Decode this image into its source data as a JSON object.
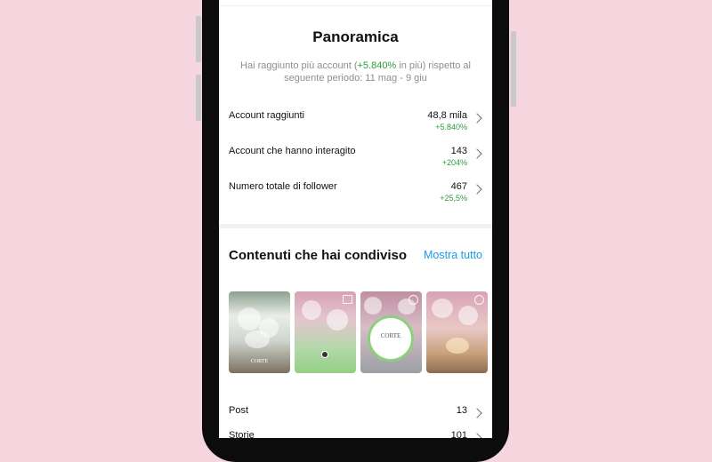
{
  "overview": {
    "title": "Panoramica",
    "subtitle_prefix": "Hai raggiunto più account (",
    "subtitle_highlight": "+5.840%",
    "subtitle_suffix": " in più) rispetto al seguente periodo: 11 mag - 9 giu",
    "metrics": [
      {
        "label": "Account raggiunti",
        "value": "48,8 mila",
        "delta": "+5.840%"
      },
      {
        "label": "Account che hanno interagito",
        "value": "143",
        "delta": "+204%"
      },
      {
        "label": "Numero totale di follower",
        "value": "467",
        "delta": "+25,5%"
      }
    ]
  },
  "content": {
    "title": "Contenuti che hai condiviso",
    "show_all": "Mostra tutto",
    "thumbnails": [
      {
        "overlay_text": "CORTE"
      },
      {
        "overlay_text": ""
      },
      {
        "overlay_text": "CORTE"
      },
      {
        "overlay_text": ""
      }
    ],
    "rows": [
      {
        "label": "Post",
        "value": "13"
      },
      {
        "label": "Storie",
        "value": "101"
      }
    ]
  },
  "colors": {
    "background": "#f5d6df",
    "accent_green": "#2e9b3f",
    "link_blue": "#1a9be8"
  }
}
